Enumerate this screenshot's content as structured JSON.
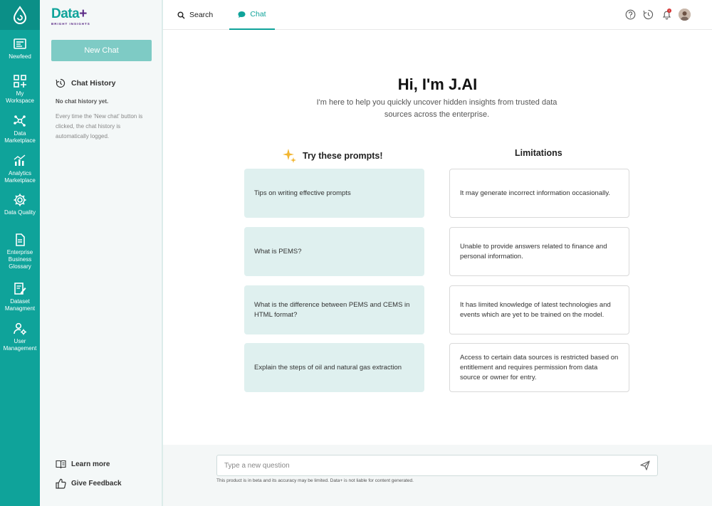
{
  "brand": {
    "name": "Data",
    "plus": "+",
    "tagline": "BRIGHT INSIGHTS"
  },
  "rail": {
    "items": [
      {
        "label": "Newfeed",
        "icon": "newsfeed-icon"
      },
      {
        "label": "My\nWorkspace",
        "icon": "workspace-grid-icon"
      },
      {
        "label": "Data\nMarketplace",
        "icon": "network-icon"
      },
      {
        "label": "Analytics\nMarketplace",
        "icon": "analytics-chart-icon"
      },
      {
        "label": "Data Quality",
        "icon": "gear-icon"
      },
      {
        "label": "Enterprise\nBusiness\nGlossary",
        "icon": "document-icon"
      },
      {
        "label": "Dataset\nManagment",
        "icon": "edit-document-icon"
      },
      {
        "label": "User\nManagement",
        "icon": "user-settings-icon"
      }
    ]
  },
  "panel": {
    "new_chat_label": "New Chat",
    "history_title": "Chat History",
    "no_history": "No chat history yet.",
    "history_hint": "Every time the 'New chat' button is clicked, the chat history is automatically logged.",
    "learn_more": "Learn more",
    "feedback": "Give Feedback"
  },
  "tabs": [
    {
      "label": "Search",
      "active": false
    },
    {
      "label": "Chat",
      "active": true
    }
  ],
  "notification_count": "1",
  "main": {
    "title": "Hi, I'm J.AI",
    "subtitle": "I'm here to help you quickly uncover hidden insights from trusted data sources across the enterprise.",
    "prompts_heading": "Try these prompts!",
    "limits_heading": "Limitations",
    "prompts": [
      "Tips on writing effective prompts",
      "What is PEMS?",
      "What is the difference between PEMS and CEMS in HTML format?",
      "Explain the steps of oil and natural gas extraction"
    ],
    "limitations": [
      "It may generate incorrect information occasionally.",
      "Unable to provide answers related to finance and personal information.",
      "It has limited knowledge of latest technologies and events which are yet to be trained on the model.",
      "Access to certain data sources is restricted based on entitlement and requires permission from data source or owner for entry."
    ]
  },
  "composer": {
    "placeholder": "Type a new question",
    "value": "",
    "disclaimer": "This product is in beta and its accuracy may be limited. Data+ is not liable for content generated."
  },
  "colors": {
    "accent": "#0fa39a",
    "brand_purple": "#5b2a86",
    "prompt_bg": "#dff0ef"
  }
}
